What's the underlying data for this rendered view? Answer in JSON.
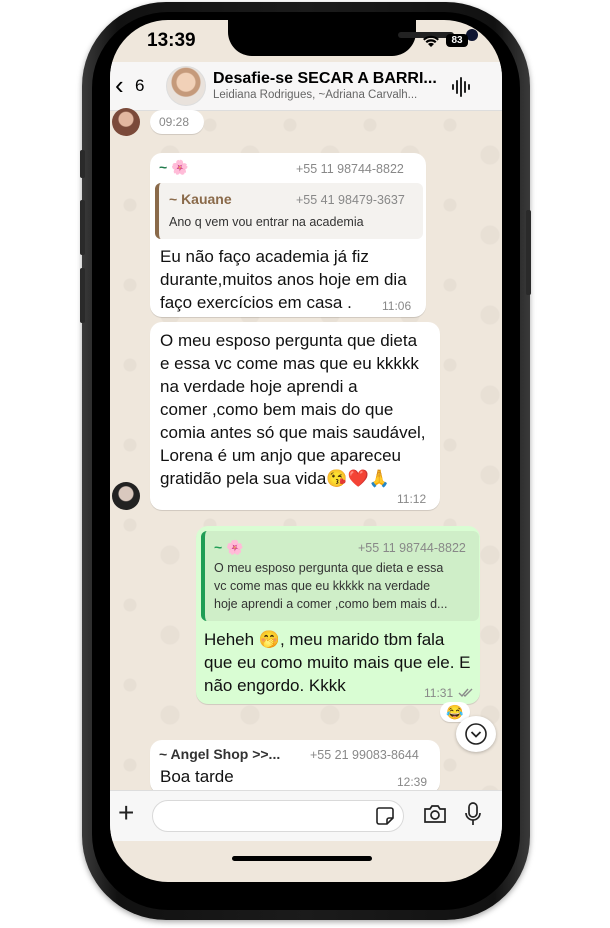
{
  "status_bar": {
    "time": "13:39",
    "battery": "83"
  },
  "header": {
    "back_count": "6",
    "title": "Desafie-se SECAR A BARRI...",
    "subtitle": "Leidiana Rodrigues, ~Adriana Carvalh..."
  },
  "messages": [
    {
      "time": "09:28"
    },
    {
      "sender": "~ 🌸",
      "phone": "+55 11 98744-8822",
      "quote": {
        "name": "~ Kauane",
        "phone": "+55 41 98479-3637",
        "text": "Ano q vem vou entrar na academia"
      },
      "lines": [
        "Eu não faço academia já fiz",
        "durante,muitos anos hoje em dia",
        "faço exercícios em casa ."
      ],
      "time": "11:06"
    },
    {
      "lines": [
        "O meu esposo pergunta que dieta",
        "e essa vc come mas que eu kkkkk",
        "na verdade hoje aprendi a",
        "comer ,como  bem mais do que",
        "comia antes só que mais saudável,",
        "Lorena é um anjo que apareceu",
        "gratidão pela sua vida😘❤️🙏"
      ],
      "time": "11:12"
    },
    {
      "quote": {
        "name": "~ 🌸",
        "phone": "+55 11 98744-8822",
        "lines": [
          "O meu esposo pergunta que dieta e essa",
          "vc come mas que eu kkkkk na verdade",
          "hoje aprendi a comer ,como  bem mais d..."
        ]
      },
      "lines": [
        "Heheh 🤭, meu marido tbm fala",
        "que eu como muito mais que ele. E",
        "não engordo. Kkkk"
      ],
      "time": "11:31",
      "reaction": "😂"
    },
    {
      "sender": "~ Angel Shop >>...",
      "phone": "+55 21 99083-8644",
      "lines": [
        "Boa tarde"
      ],
      "time": "12:39"
    }
  ]
}
